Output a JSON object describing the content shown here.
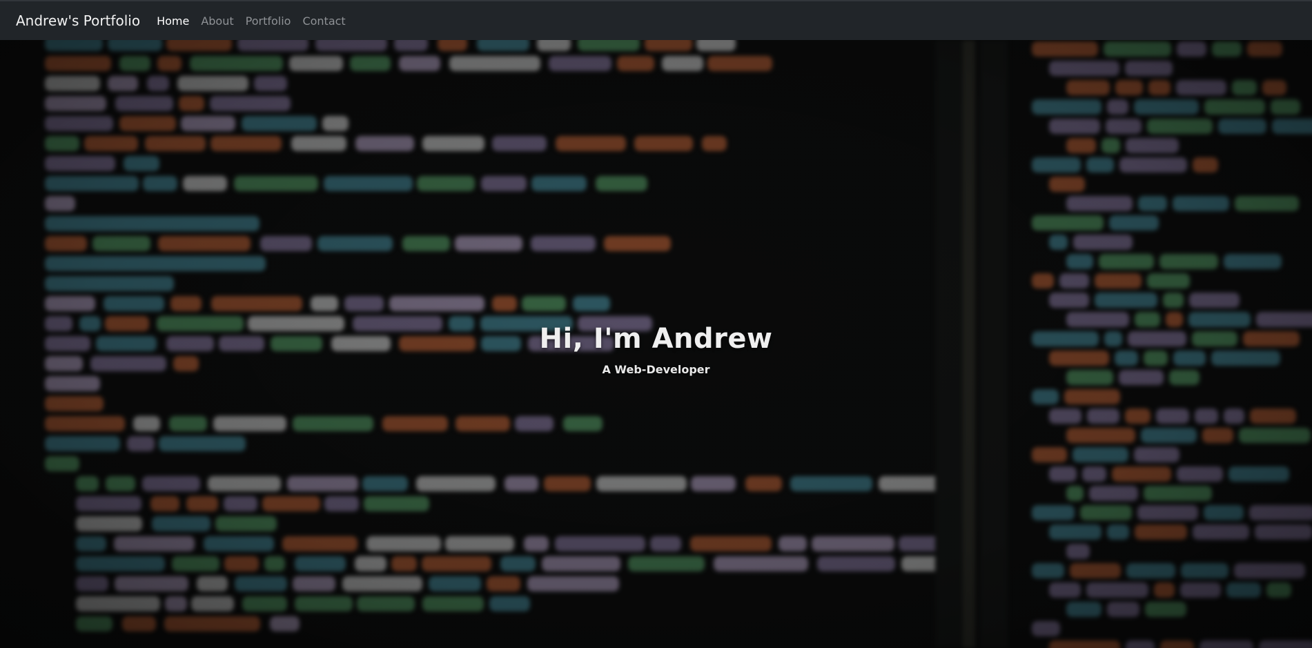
{
  "navbar": {
    "brand": "Andrew's Portfolio",
    "links": [
      {
        "label": "Home",
        "active": true
      },
      {
        "label": "About",
        "active": false
      },
      {
        "label": "Portfolio",
        "active": false
      },
      {
        "label": "Contact",
        "active": false
      }
    ]
  },
  "hero": {
    "title": "Hi, I'm Andrew",
    "subtitle": "A Web-Developer",
    "background": "blurred-code-editor-photo"
  },
  "colors": {
    "navbar_bg": "#212529",
    "nav_active": "#ffffff",
    "nav_inactive": "#8f9296",
    "code_purple": "#8e7fa8",
    "code_green": "#5aa16a",
    "code_orange": "#c2653a",
    "code_teal": "#4a8fa0"
  }
}
